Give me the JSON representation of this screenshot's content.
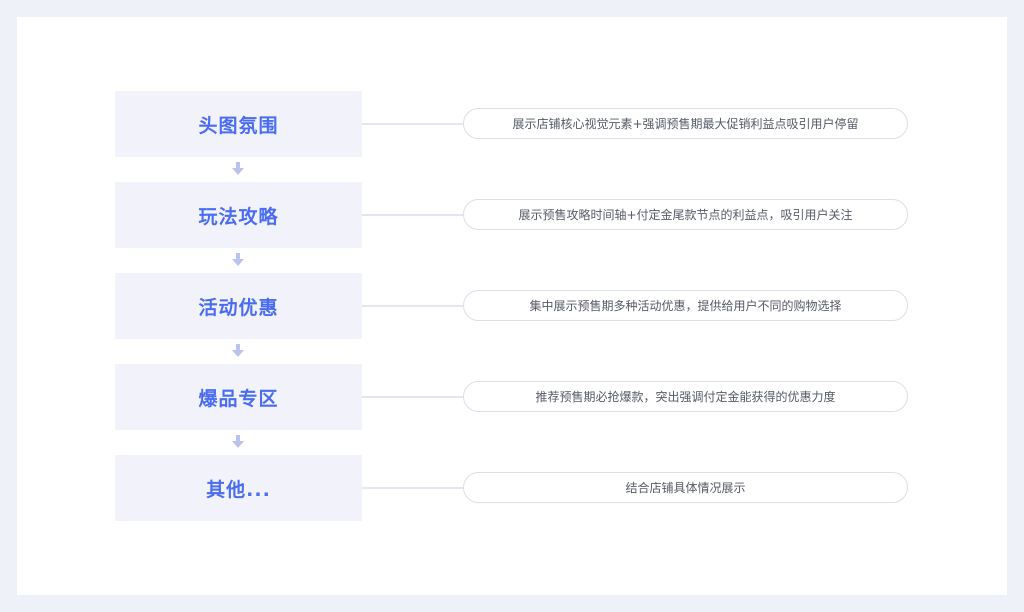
{
  "steps": [
    {
      "label": "头图氛围",
      "description": "展示店铺核心视觉元素+强调预售期最大促销利益点吸引用户停留"
    },
    {
      "label": "玩法攻略",
      "description": "展示预售攻略时间轴+付定金尾款节点的利益点，吸引用户关注"
    },
    {
      "label": "活动优惠",
      "description": "集中展示预售期多种活动优惠，提供给用户不同的购物选择"
    },
    {
      "label": "爆品专区",
      "description": "推荐预售期必抢爆款，突出强调付定金能获得的优惠力度"
    },
    {
      "label": "其他...",
      "description": "结合店铺具体情况展示"
    }
  ],
  "colors": {
    "accent": "#4a6cf0",
    "step_bg": "#f2f3fa",
    "arrow": "#b9c3ee",
    "page_bg": "#eef1f8"
  }
}
